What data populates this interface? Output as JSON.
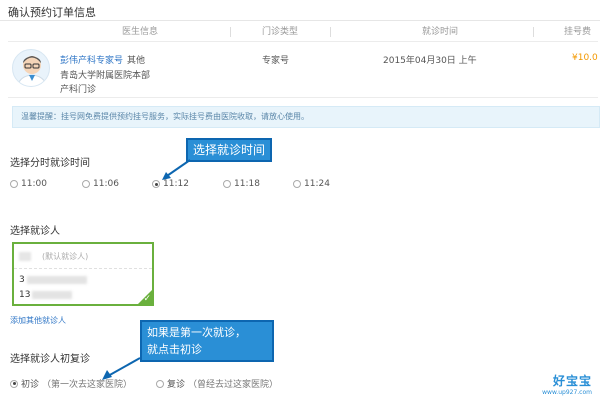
{
  "page_title": "确认预约订单信息",
  "table_headers": {
    "doctor": "医生信息",
    "clinic_type": "门诊类型",
    "visit_time": "就诊时间",
    "fee": "挂号费"
  },
  "doctor": {
    "name": "彭伟产科专家号",
    "tag": "其他",
    "hospital": "青岛大学附属医院本部",
    "department": "产科门诊",
    "clinic_type": "专家号",
    "visit_time": "2015年04月30日 上午",
    "fee": "¥10.0"
  },
  "notice": "温馨提醒：挂号网免费提供预约挂号服务，实际挂号费由医院收取，请放心使用。",
  "time_section": {
    "title": "选择分时就诊时间",
    "callout": "选择就诊时间",
    "options": [
      "11:00",
      "11:06",
      "11:12",
      "11:18",
      "11:24"
    ],
    "selected": "11:12"
  },
  "patient_section": {
    "title": "选择就诊人",
    "default_label": "(默认就诊人)",
    "id_prefix": "3",
    "phone_prefix": "13",
    "add_link": "添加其他就诊人"
  },
  "visit_type_section": {
    "title": "选择就诊人初复诊",
    "callout_line1": "如果是第一次就诊，",
    "callout_line2": "就点击初诊",
    "first_visit": "初诊",
    "first_visit_note": "（第一次去这家医院）",
    "return_visit": "复诊",
    "return_visit_note": "（曾经去过这家医院）",
    "selected": "初诊"
  },
  "watermark": {
    "name": "好宝宝",
    "url": "www.up927.com"
  },
  "colors": {
    "link_blue": "#2f76c6",
    "fee_orange": "#f39800",
    "selected_green": "#6ab03d",
    "callout_blue": "#2a8fd6"
  }
}
